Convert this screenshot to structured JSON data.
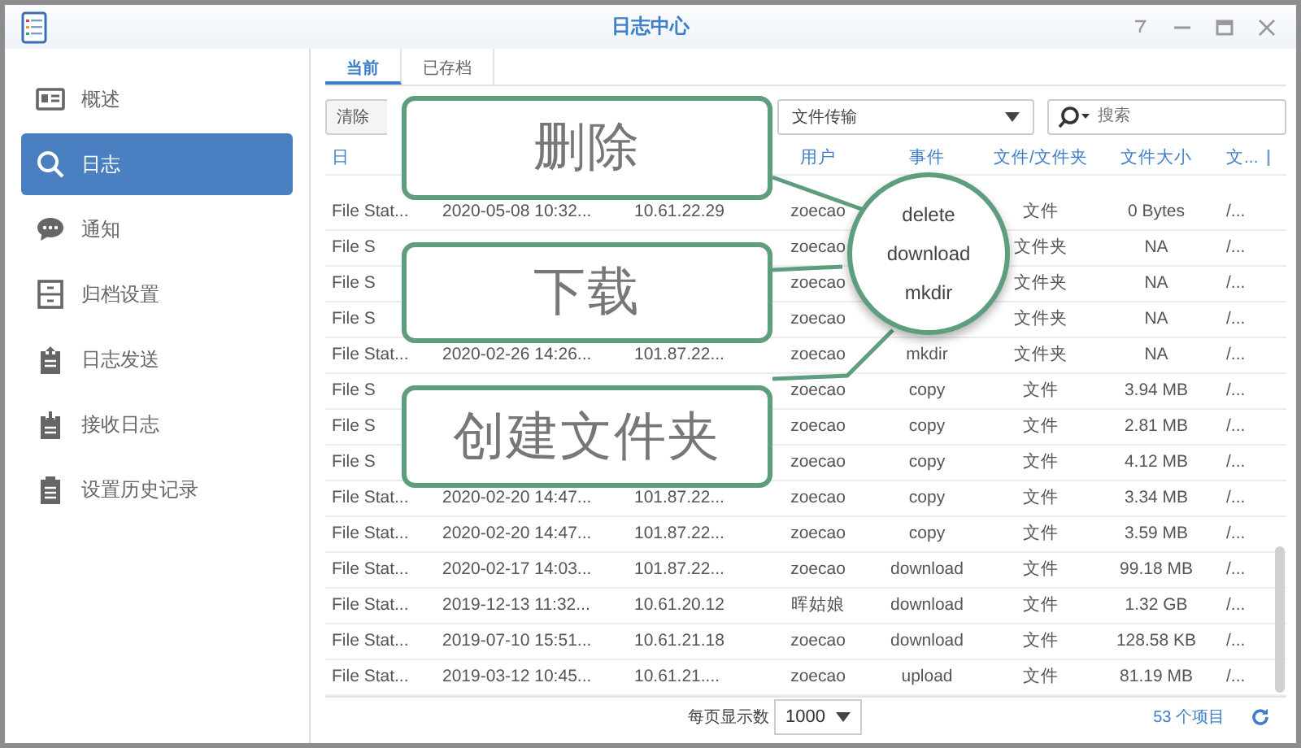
{
  "window": {
    "title": "日志中心"
  },
  "sidebar": {
    "items": [
      {
        "label": "概述",
        "selected": false
      },
      {
        "label": "日志",
        "selected": true
      },
      {
        "label": "通知",
        "selected": false
      },
      {
        "label": "归档设置",
        "selected": false
      },
      {
        "label": "日志发送",
        "selected": false
      },
      {
        "label": "接收日志",
        "selected": false
      },
      {
        "label": "设置历史记录",
        "selected": false
      }
    ]
  },
  "tabs": [
    {
      "label": "当前",
      "selected": true
    },
    {
      "label": "已存档",
      "selected": false
    }
  ],
  "toolbar": {
    "clear_button": "清除",
    "filter": {
      "value": "文件传输"
    },
    "search": {
      "placeholder": "搜索"
    }
  },
  "table": {
    "columns": [
      "日",
      null,
      null,
      "用户",
      "事件",
      "文件/文件夹",
      "文件大小",
      "文..."
    ],
    "rows": [
      {
        "cells": [
          "File Stat...",
          "2020-05-08 10:32...",
          "10.61.22.29",
          "zoecao",
          null,
          "文件",
          "0 Bytes",
          "/..."
        ]
      },
      {
        "cells": [
          "File S",
          null,
          null,
          "zoecao",
          null,
          "文件夹",
          "NA",
          "/..."
        ]
      },
      {
        "cells": [
          "File S",
          null,
          null,
          "zoecao",
          null,
          "文件夹",
          "NA",
          "/..."
        ]
      },
      {
        "cells": [
          "File S",
          null,
          null,
          "zoecao",
          null,
          "文件夹",
          "NA",
          "/..."
        ]
      },
      {
        "cells": [
          "File Stat...",
          "2020-02-26 14:26...",
          "101.87.22...",
          "zoecao",
          "mkdir",
          "文件夹",
          "NA",
          "/..."
        ]
      },
      {
        "cells": [
          "File S",
          null,
          null,
          "zoecao",
          "copy",
          "文件",
          "3.94 MB",
          "/..."
        ]
      },
      {
        "cells": [
          "File S",
          null,
          null,
          "zoecao",
          "copy",
          "文件",
          "2.81 MB",
          "/..."
        ]
      },
      {
        "cells": [
          "File S",
          null,
          null,
          "zoecao",
          "copy",
          "文件",
          "4.12 MB",
          "/..."
        ]
      },
      {
        "cells": [
          "File Stat...",
          "2020-02-20 14:47...",
          "101.87.22...",
          "zoecao",
          "copy",
          "文件",
          "3.34 MB",
          "/..."
        ]
      },
      {
        "cells": [
          "File Stat...",
          "2020-02-20 14:47...",
          "101.87.22...",
          "zoecao",
          "copy",
          "文件",
          "3.59 MB",
          "/..."
        ]
      },
      {
        "cells": [
          "File Stat...",
          "2020-02-17 14:03...",
          "101.87.22...",
          "zoecao",
          "download",
          "文件",
          "99.18 MB",
          "/..."
        ]
      },
      {
        "cells": [
          "File Stat...",
          "2019-12-13 11:32...",
          "10.61.20.12",
          "晖姑娘",
          "download",
          "文件",
          "1.32 GB",
          "/..."
        ]
      },
      {
        "cells": [
          "File Stat...",
          "2019-07-10 15:51...",
          "10.61.21.18",
          "zoecao",
          "download",
          "文件",
          "128.58 KB",
          "/..."
        ]
      },
      {
        "cells": [
          "File Stat...",
          "2019-03-12 10:45...",
          "10.61.21....",
          "zoecao",
          "upload",
          "文件",
          "81.19 MB",
          "/..."
        ]
      }
    ]
  },
  "footer": {
    "page_size_label": "每页显示数",
    "page_size": "1000",
    "count": "53 个项目"
  },
  "callouts": [
    {
      "text": "删除"
    },
    {
      "text": "下载"
    },
    {
      "text": "创建文件夹"
    }
  ],
  "magnifier": {
    "items": [
      "delete",
      "download",
      "mkdir"
    ]
  }
}
